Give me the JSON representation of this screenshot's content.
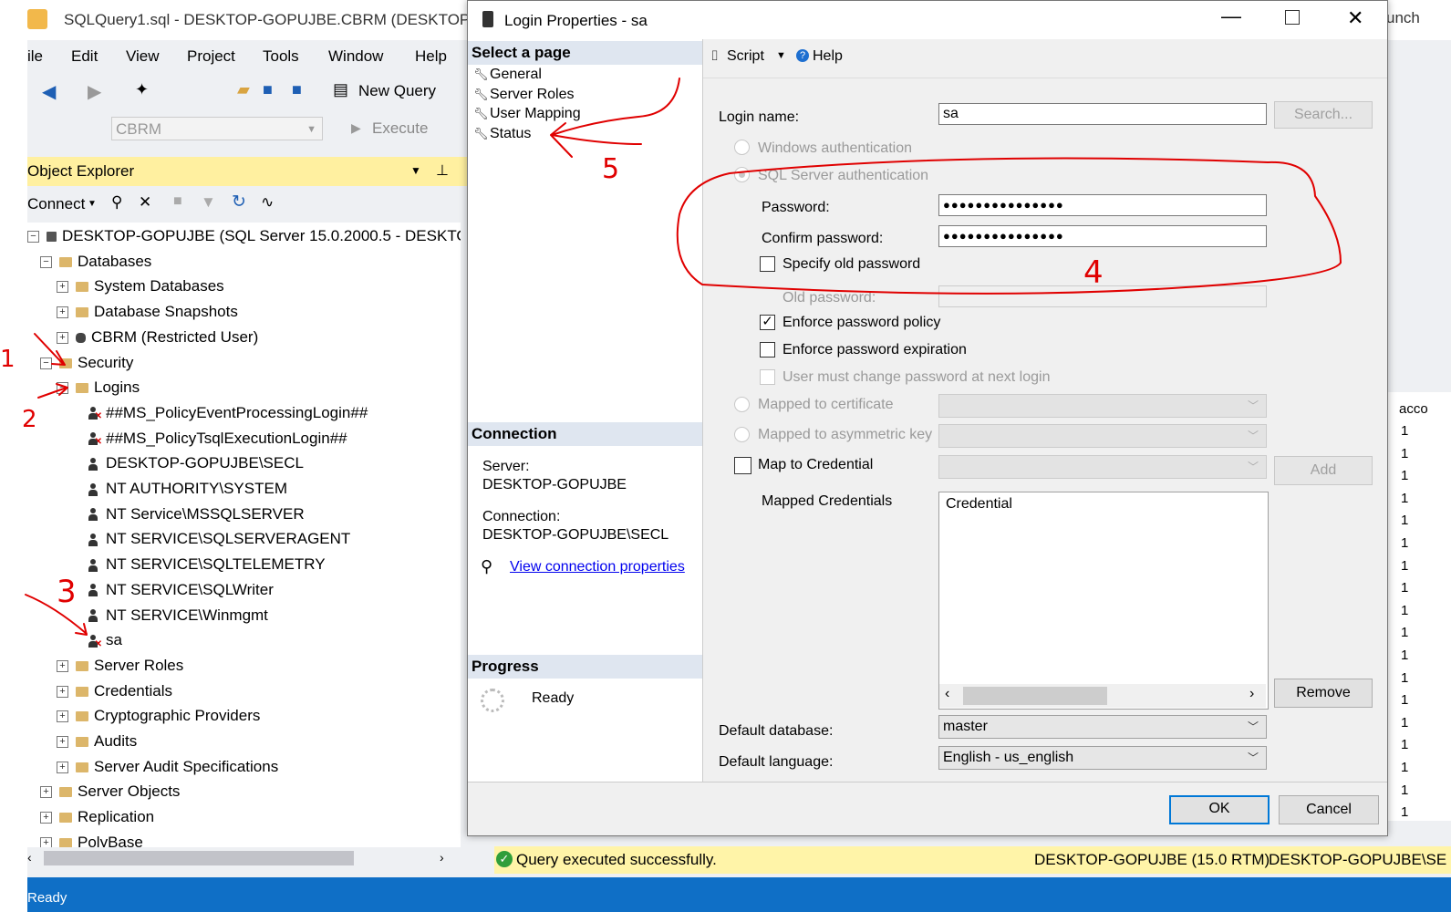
{
  "ssms": {
    "title": "SQLQuery1.sql - DESKTOP-GOPUJBE.CBRM (DESKTOP-G",
    "title_right": "unch",
    "menu": [
      "ile",
      "Edit",
      "View",
      "Project",
      "Tools",
      "Window",
      "Help"
    ],
    "toolbar": {
      "new_query": "New Query",
      "database": "CBRM",
      "execute": "Execute"
    },
    "object_explorer": {
      "title": "Object Explorer",
      "connect": "Connect",
      "tree": [
        {
          "text": "DESKTOP-GOPUJBE (SQL Server 15.0.2000.5 - DESKTOP-",
          "level": 0,
          "icon": "server",
          "exp": "−"
        },
        {
          "text": "Databases",
          "level": 1,
          "icon": "folder",
          "exp": "−"
        },
        {
          "text": "System Databases",
          "level": 2,
          "icon": "folder",
          "exp": "+"
        },
        {
          "text": "Database Snapshots",
          "level": 2,
          "icon": "folder",
          "exp": "+"
        },
        {
          "text": "CBRM (Restricted User)",
          "level": 2,
          "icon": "database",
          "exp": "+"
        },
        {
          "text": "Security",
          "level": 1,
          "icon": "folder",
          "exp": "−"
        },
        {
          "text": "Logins",
          "level": 2,
          "icon": "folder",
          "exp": "−"
        },
        {
          "text": "##MS_PolicyEventProcessingLogin##",
          "level": 3,
          "icon": "user-disabled",
          "exp": ""
        },
        {
          "text": "##MS_PolicyTsqlExecutionLogin##",
          "level": 3,
          "icon": "user-disabled",
          "exp": ""
        },
        {
          "text": "DESKTOP-GOPUJBE\\SECL",
          "level": 3,
          "icon": "user",
          "exp": ""
        },
        {
          "text": "NT AUTHORITY\\SYSTEM",
          "level": 3,
          "icon": "user",
          "exp": ""
        },
        {
          "text": "NT Service\\MSSQLSERVER",
          "level": 3,
          "icon": "user",
          "exp": ""
        },
        {
          "text": "NT SERVICE\\SQLSERVERAGENT",
          "level": 3,
          "icon": "user",
          "exp": ""
        },
        {
          "text": "NT SERVICE\\SQLTELEMETRY",
          "level": 3,
          "icon": "user",
          "exp": ""
        },
        {
          "text": "NT SERVICE\\SQLWriter",
          "level": 3,
          "icon": "user",
          "exp": ""
        },
        {
          "text": "NT SERVICE\\Winmgmt",
          "level": 3,
          "icon": "user",
          "exp": ""
        },
        {
          "text": "sa",
          "level": 3,
          "icon": "user-disabled",
          "exp": ""
        },
        {
          "text": "Server Roles",
          "level": 2,
          "icon": "folder",
          "exp": "+"
        },
        {
          "text": "Credentials",
          "level": 2,
          "icon": "folder",
          "exp": "+"
        },
        {
          "text": "Cryptographic Providers",
          "level": 2,
          "icon": "folder",
          "exp": "+"
        },
        {
          "text": "Audits",
          "level": 2,
          "icon": "folder",
          "exp": "+"
        },
        {
          "text": "Server Audit Specifications",
          "level": 2,
          "icon": "folder",
          "exp": "+"
        },
        {
          "text": "Server Objects",
          "level": 1,
          "icon": "folder",
          "exp": "+"
        },
        {
          "text": "Replication",
          "level": 1,
          "icon": "folder",
          "exp": "+"
        },
        {
          "text": "PolyBase",
          "level": 1,
          "icon": "folder",
          "exp": "+"
        }
      ]
    },
    "query_status": "Query executed successfully.",
    "server_info": "DESKTOP-GOPUJBE (15.0 RTM)",
    "server_user": "DESKTOP-GOPUJBE\\SE",
    "status_bar": "Ready",
    "results_header": "acco",
    "results_values": [
      "1",
      "1",
      "1",
      "1",
      "1",
      "1",
      "1",
      "1",
      "1",
      "1",
      "1",
      "1",
      "1",
      "1",
      "1",
      "1",
      "1",
      "1"
    ]
  },
  "dialog": {
    "title": "Login Properties - sa",
    "select_page_header": "Select a page",
    "pages": [
      "General",
      "Server Roles",
      "User Mapping",
      "Status"
    ],
    "connection_header": "Connection",
    "server_label": "Server:",
    "server_value": "DESKTOP-GOPUJBE",
    "connection_label": "Connection:",
    "connection_value": "DESKTOP-GOPUJBE\\SECL",
    "view_connection_link": "View connection properties",
    "progress_header": "Progress",
    "progress_status": "Ready",
    "toolbar": {
      "script": "Script",
      "help": "Help"
    },
    "login_name_label": "Login name:",
    "login_name_value": "sa",
    "search_button": "Search...",
    "windows_auth": "Windows authentication",
    "sql_auth": "SQL Server authentication",
    "password_label": "Password:",
    "password_value": "●●●●●●●●●●●●●●●",
    "confirm_password_label": "Confirm password:",
    "confirm_password_value": "●●●●●●●●●●●●●●●",
    "specify_old_password": "Specify old password",
    "old_password_label": "Old password:",
    "enforce_policy": "Enforce password policy",
    "enforce_policy_checked": "✓",
    "enforce_expiration": "Enforce password expiration",
    "must_change": "User must change password at next login",
    "mapped_certificate": "Mapped to certificate",
    "mapped_asym_key": "Mapped to asymmetric key",
    "map_credential": "Map to Credential",
    "add_button": "Add",
    "mapped_credentials_label": "Mapped Credentials",
    "credential_column": "Credential",
    "remove_button": "Remove",
    "default_database_label": "Default database:",
    "default_database_value": "master",
    "default_language_label": "Default language:",
    "default_language_value": "English - us_english",
    "ok_button": "OK",
    "cancel_button": "Cancel"
  },
  "annotations": [
    "1",
    "2",
    "3",
    "4",
    "5"
  ],
  "colors": {
    "annotation": "#e00000",
    "oe_header": "#fff0a0",
    "statusbar": "#0f6fc6",
    "link": "#0000ee"
  }
}
